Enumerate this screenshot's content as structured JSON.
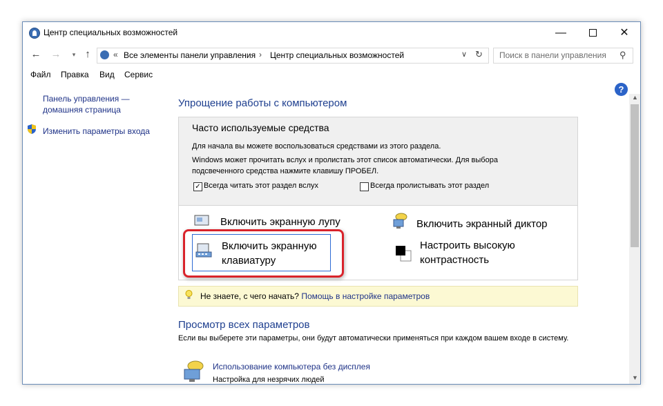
{
  "window": {
    "title": "Центр специальных возможностей",
    "controls": {
      "minimize": "—",
      "close": "✕"
    }
  },
  "nav": {
    "back_icon": "←",
    "forward_icon": "→",
    "recent_icon": "▾",
    "up_icon": "↑",
    "breadcrumb_chevron": "«",
    "breadcrumb": [
      "Все элементы панели управления",
      "Центр специальных возможностей"
    ],
    "breadcrumb_sep": "›",
    "dropdown_icon": "∨",
    "refresh_icon": "↻",
    "search_placeholder": "Поиск в панели управления",
    "search_icon": "⚲"
  },
  "menu": [
    "Файл",
    "Правка",
    "Вид",
    "Сервис"
  ],
  "sidebar": {
    "home_link_line1": "Панель управления —",
    "home_link_line2": "домашняя страница",
    "signin_link": "Изменить параметры входа"
  },
  "help": "?",
  "scroll": {
    "up": "▲",
    "down": "▼"
  },
  "main": {
    "heading": "Упрощение работы с компьютером",
    "panel": {
      "title": "Часто используемые средства",
      "intro": "Для начала вы можете воспользоваться средствами из этого раздела.",
      "desc_line1": "Windows может прочитать вслух и пролистать этот список автоматически. Для выбора",
      "desc_line2": "подсвеченного средства нажмите клавишу ПРОБЕЛ.",
      "checkbox_read": {
        "label": "Всегда читать этот раздел вслух",
        "checked": true,
        "mark": "✓"
      },
      "checkbox_scan": {
        "label": "Всегда пролистывать этот раздел",
        "checked": false
      }
    },
    "tools": {
      "magnifier": "Включить экранную лупу",
      "narrator": "Включить экранный диктор",
      "keyboard_line1": "Включить экранную",
      "keyboard_line2": "клавиатуру",
      "contrast_line1": "Настроить высокую",
      "contrast_line2": "контрастность"
    },
    "hint": {
      "icon": "💡",
      "text": "Не знаете, с чего начать?",
      "link": "Помощь в настройке параметров"
    },
    "section2": {
      "heading": "Просмотр всех параметров",
      "desc": "Если вы выберете эти параметры, они будут автоматически применяться при каждом вашем входе в систему.",
      "item_link": "Использование компьютера без дисплея",
      "item_desc": "Настройка для незрячих людей"
    }
  },
  "colors": {
    "link": "#1e3287",
    "heading": "#1e3f8f",
    "highlight_frame": "#d9232b",
    "focus_border": "#2c6ad4"
  }
}
